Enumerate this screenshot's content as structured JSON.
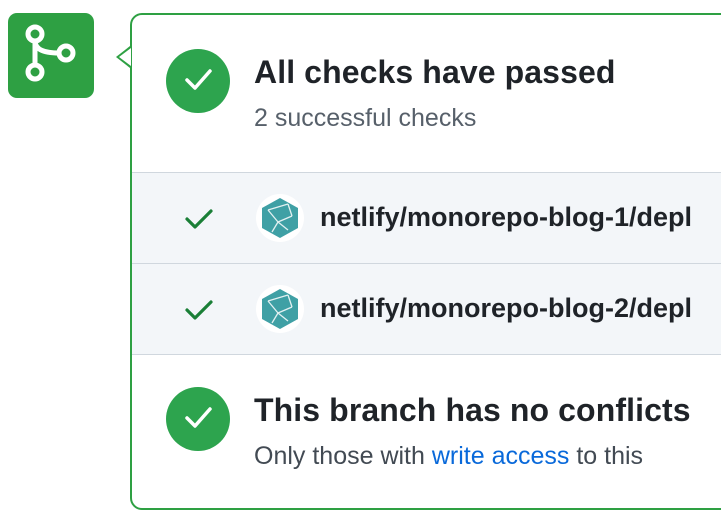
{
  "merge_icon": "git-branch-icon",
  "checks_section": {
    "title": "All checks have passed",
    "subtitle": "2 successful checks",
    "status_icon": "check-icon"
  },
  "checks": [
    {
      "name": "netlify/monorepo-blog-1/depl",
      "icon": "netlify-logo-icon",
      "status_icon": "check-icon"
    },
    {
      "name": "netlify/monorepo-blog-2/depl",
      "icon": "netlify-logo-icon",
      "status_icon": "check-icon"
    }
  ],
  "conflicts_section": {
    "title": "This branch has no conflicts",
    "text_before": "Only those with ",
    "link_text": "write access",
    "text_after": " to this"
  },
  "colors": {
    "success": "#2da44e",
    "border": "#2ea043",
    "link": "#0969da",
    "row_bg": "#f3f6f9",
    "netlify": "#3fa0a5"
  }
}
